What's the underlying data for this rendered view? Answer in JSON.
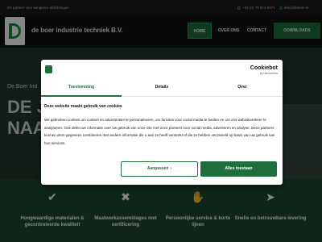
{
  "topbar": {
    "tagline": "De partner voor kangeren afdichtingen",
    "phone": "+31 (0) 78 614 8671",
    "email": "info@deboer.nl"
  },
  "header": {
    "brand": "de boer industrie techniek B.V.",
    "menu": {
      "home": "HOME",
      "over": "OVER ONS",
      "contact": "CONTACT"
    },
    "downloads": "DOWNLOADS"
  },
  "hero": {
    "subtitle": "De Boer Ind",
    "line1": "DE J",
    "line2": "NAA"
  },
  "features": [
    {
      "icon": "shield-check-icon",
      "glyph": "✔",
      "label": "Hoogwaardige materialen & gecontroleerde kwaliteit"
    },
    {
      "icon": "tools-icon",
      "glyph": "✖",
      "label": "Maatwerkassemblages met certificering"
    },
    {
      "icon": "handshake-icon",
      "glyph": "✋",
      "label": "Persoonlijke service & korte lijnen"
    },
    {
      "icon": "delivery-icon",
      "glyph": "➤",
      "label": "Snelle en betrouwbare levering"
    }
  ],
  "cookie_dialog": {
    "brand": "Cookiebot",
    "brand_sub": "by Usercentrics",
    "tabs": [
      "Toestemming",
      "Details",
      "Over"
    ],
    "title": "Deze website maakt gebruik van cookies",
    "body": "We gebruiken cookies om content en advertenties te personaliseren, om functies voor social media te bieden en om ons websiteverkeer te analyseren. Ook delen we informatie over uw gebruik van onze site met onze partners voor social media, adverteren en analyse. Deze partners kunnen deze gegevens combineren met andere informatie die u aan ze heeft verstrekt of die ze hebben verzameld op basis van uw gebruik van hun services.",
    "customize_label": "Aanpassen",
    "allow_all_label": "Alles toestaan"
  },
  "colors": {
    "accent": "#1e6e3e",
    "topbar": "#1c1c1c",
    "nav": "#0e1512",
    "features": "#1b4a30"
  }
}
